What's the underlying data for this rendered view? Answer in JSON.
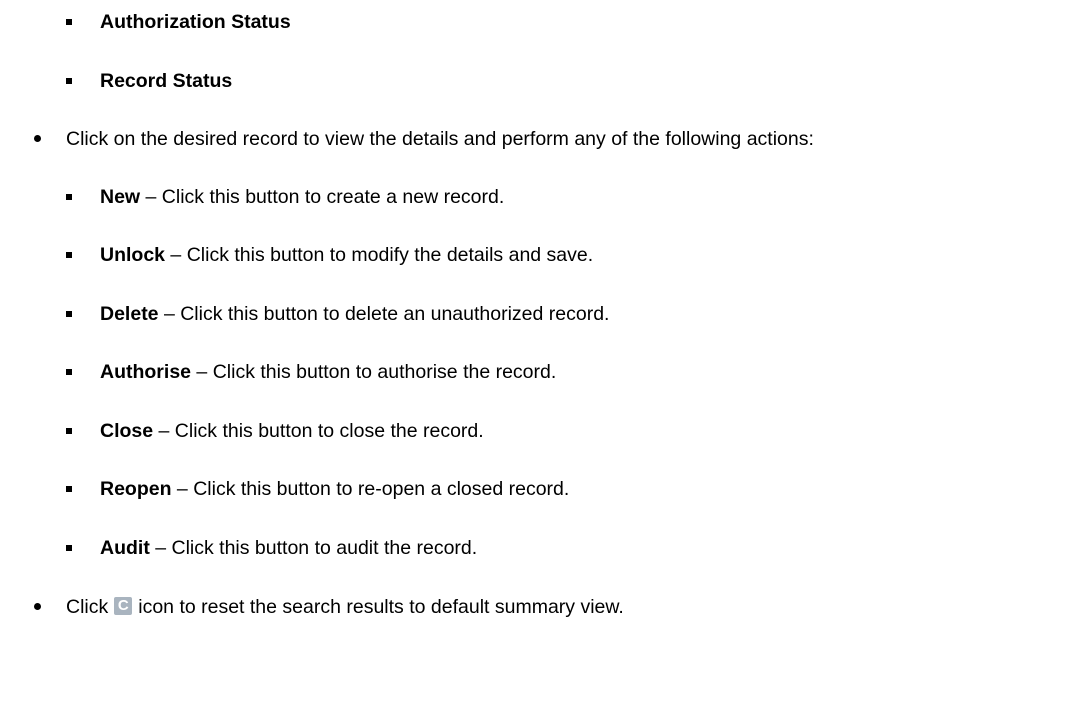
{
  "search_fields": [
    "Authorization Status",
    "Record Status"
  ],
  "record_step": {
    "text": "Click on the desired record to view the details and perform any of the following actions:"
  },
  "actions": [
    {
      "label": "New",
      "desc": " – Click this button to create a new record."
    },
    {
      "label": "Unlock",
      "desc": " – Click this button to modify the details and save."
    },
    {
      "label": "Delete",
      "desc": " – Click this button to delete an unauthorized record."
    },
    {
      "label": "Authorise",
      "desc": " – Click this button to authorise the record."
    },
    {
      "label": "Close",
      "desc": " – Click this button to close the record."
    },
    {
      "label": "Reopen",
      "desc": " – Click this button to re-open a closed record."
    },
    {
      "label": "Audit",
      "desc": " – Click this button to audit the record."
    }
  ],
  "reset_step": {
    "before": "Click",
    "icon": "refresh-icon",
    "icon_glyph": "C",
    "after": "icon to reset the search results to default summary view."
  }
}
